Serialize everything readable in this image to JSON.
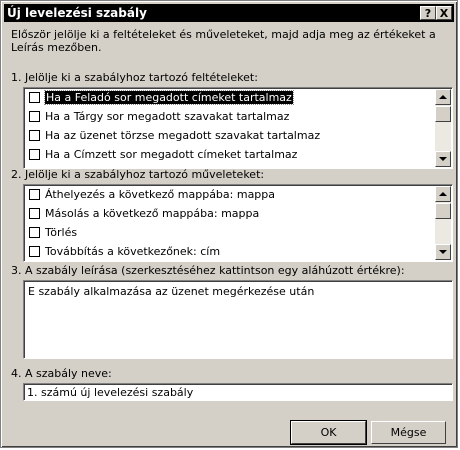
{
  "window": {
    "title": "Új levelezési szabály",
    "help_button": "?",
    "close_button": "X"
  },
  "intro": "Először jelölje ki a feltételeket és műveleteket, majd adja meg az értékeket a Leírás mezőben.",
  "conditions": {
    "label": "1. Jelölje ki a szabályhoz tartozó feltételeket:",
    "items": [
      {
        "label": "Ha a Feladó sor megadott címeket tartalmaz",
        "checked": false,
        "selected": true
      },
      {
        "label": "Ha a Tárgy sor megadott szavakat tartalmaz",
        "checked": false,
        "selected": false
      },
      {
        "label": "Ha az üzenet törzse megadott szavakat tartalmaz",
        "checked": false,
        "selected": false
      },
      {
        "label": "Ha a Címzett sor megadott címeket tartalmaz",
        "checked": false,
        "selected": false
      }
    ]
  },
  "actions": {
    "label": "2. Jelölje ki a szabályhoz tartozó műveleteket:",
    "items": [
      {
        "label": "Áthelyezés a következő mappába: mappa",
        "checked": false
      },
      {
        "label": "Másolás a következő mappába: mappa",
        "checked": false
      },
      {
        "label": "Törlés",
        "checked": false
      },
      {
        "label": "Továbbítás a következőnek: cím",
        "checked": false
      }
    ]
  },
  "description": {
    "label": "3. A szabály leírása (szerkesztéséhez kattintson egy aláhúzott értékre):",
    "text": "E szabály alkalmazása az üzenet megérkezése után"
  },
  "rule_name": {
    "label": "4. A szabály neve:",
    "value": "1. számú új levelezési szabály"
  },
  "buttons": {
    "ok": "OK",
    "cancel": "Mégse"
  }
}
